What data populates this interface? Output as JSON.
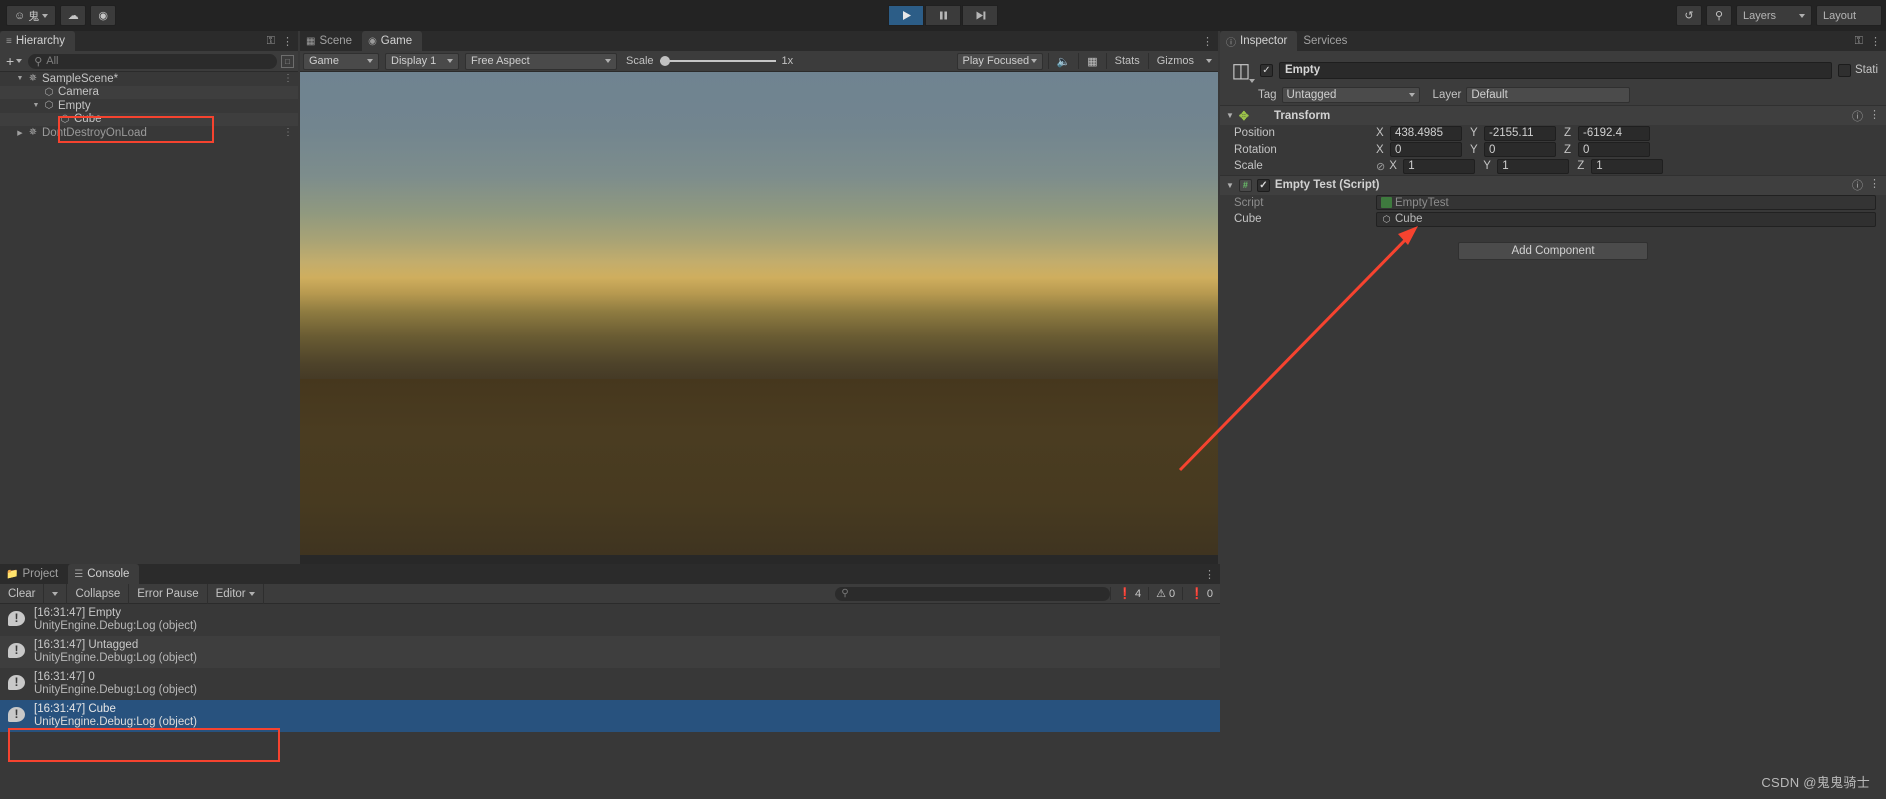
{
  "toolbar": {
    "account_icon": "account-icon",
    "account_label": "鬼",
    "cloud_icon": "cloud-icon",
    "collab_icon": "collab-icon",
    "play_icon": "play-icon",
    "pause_icon": "pause-icon",
    "step_icon": "step-icon",
    "history_icon": "history-icon",
    "search_icon": "search-icon",
    "layers_label": "Layers",
    "layout_label": "Layout"
  },
  "hierarchy": {
    "tab_label": "Hierarchy",
    "tab_icon": "hierarchy-icon",
    "lock_icon": "lock-icon",
    "menu_icon": "kebab-menu-icon",
    "add_label": "+",
    "search_placeholder": "All",
    "search_icon": "search-icon",
    "items": [
      {
        "label": "SampleScene*",
        "depth": 0,
        "icon": "scene-icon",
        "expanded": true,
        "menu": true
      },
      {
        "label": "Camera",
        "depth": 1,
        "icon": "gameobject-icon",
        "expanded": null,
        "menu": false
      },
      {
        "label": "Empty",
        "depth": 1,
        "icon": "gameobject-icon",
        "expanded": true,
        "menu": false
      },
      {
        "label": "Cube",
        "depth": 2,
        "icon": "gameobject-icon",
        "expanded": null,
        "menu": false
      },
      {
        "label": "DontDestroyOnLoad",
        "depth": 0,
        "icon": "scene-icon",
        "expanded": false,
        "menu": true
      }
    ]
  },
  "gameview": {
    "tabs": [
      {
        "label": "Scene",
        "icon": "scene-tab-icon",
        "active": false
      },
      {
        "label": "Game",
        "icon": "game-tab-icon",
        "active": true
      }
    ],
    "lock_icon": "lock-icon",
    "menu_icon": "kebab-menu-icon",
    "display_mode": "Game",
    "display_num": "Display 1",
    "aspect": "Free Aspect",
    "scale_label": "Scale",
    "scale_value": "1x",
    "play_mode": "Play Focused",
    "mute_icon": "mute-audio-icon",
    "frame_icon": "frame-debugger-icon",
    "stats_label": "Stats",
    "gizmos_label": "Gizmos"
  },
  "inspector": {
    "tabs": [
      {
        "label": "Inspector",
        "icon": "info-icon",
        "active": true
      },
      {
        "label": "Services",
        "icon": "services-icon",
        "active": false
      }
    ],
    "lock_icon": "lock-icon",
    "object_icon": "gameobject-icon",
    "enabled": true,
    "name": "Empty",
    "static_label": "Stati",
    "tag_label": "Tag",
    "tag_value": "Untagged",
    "layer_label": "Layer",
    "layer_value": "Default",
    "help_icon": "help-icon",
    "preset_icon": "preset-icon",
    "transform": {
      "title": "Transform",
      "icon": "transform-icon",
      "rows": [
        {
          "label": "Position",
          "x": "438.4985",
          "y": "-2155.11",
          "z": "-6192.4",
          "eye": false
        },
        {
          "label": "Rotation",
          "x": "0",
          "y": "0",
          "z": "0",
          "eye": false
        },
        {
          "label": "Scale",
          "x": "1",
          "y": "1",
          "z": "1",
          "eye": true
        }
      ],
      "axis_x": "X",
      "axis_y": "Y",
      "axis_z": "Z"
    },
    "script_component": {
      "title": "Empty Test (Script)",
      "enabled": true,
      "icon": "cs-script-icon",
      "fields": [
        {
          "label": "Script",
          "value": "EmptyTest",
          "icon": "script-asset-icon",
          "dim": true
        },
        {
          "label": "Cube",
          "value": "Cube",
          "icon": "gameobject-icon",
          "dim": false
        }
      ]
    },
    "add_component_label": "Add Component"
  },
  "console": {
    "tabs": [
      {
        "label": "Project",
        "icon": "folder-icon",
        "active": false
      },
      {
        "label": "Console",
        "icon": "console-icon",
        "active": true
      }
    ],
    "menu_icon": "kebab-menu-icon",
    "clear_label": "Clear",
    "collapse_label": "Collapse",
    "error_pause_label": "Error Pause",
    "editor_label": "Editor",
    "search_icon": "search-icon",
    "search_value": "",
    "counters": [
      {
        "icon": "log-icon",
        "count": "4"
      },
      {
        "icon": "warning-icon",
        "count": "0"
      },
      {
        "icon": "error-icon",
        "count": "0"
      }
    ],
    "logs": [
      {
        "message": "[16:31:47] Empty",
        "stack": "UnityEngine.Debug:Log (object)",
        "selected": false
      },
      {
        "message": "[16:31:47] Untagged",
        "stack": "UnityEngine.Debug:Log (object)",
        "selected": false
      },
      {
        "message": "[16:31:47] 0",
        "stack": "UnityEngine.Debug:Log (object)",
        "selected": false
      },
      {
        "message": "[16:31:47] Cube",
        "stack": "UnityEngine.Debug:Log (object)",
        "selected": true
      }
    ]
  },
  "watermark": "CSDN @鬼鬼骑士",
  "annotation": {
    "color": "#f6432f"
  }
}
